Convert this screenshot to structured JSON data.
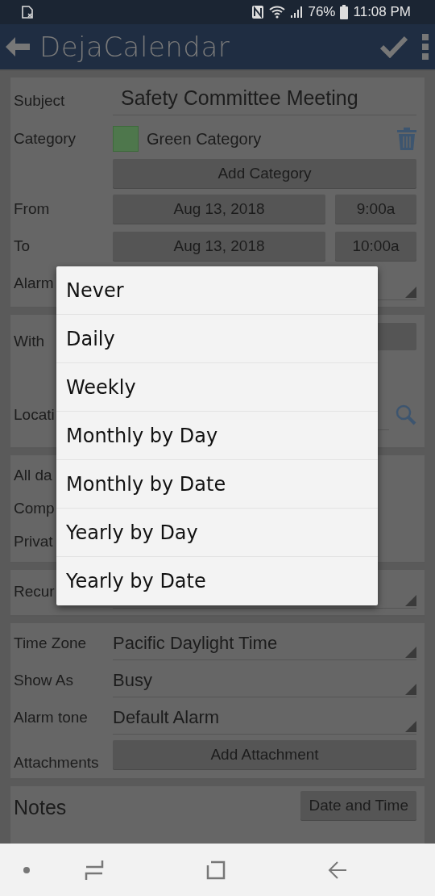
{
  "status_bar": {
    "battery": "76%",
    "time": "11:08 PM"
  },
  "app_bar": {
    "title": "DejaCalendar"
  },
  "details": {
    "subject": {
      "label": "Subject",
      "value": "Safety Committee Meeting"
    },
    "category": {
      "label": "Category",
      "name": "Green Category",
      "color": "#4e774c"
    },
    "add_category": "Add Category",
    "from": {
      "label": "From",
      "date": "Aug 13, 2018",
      "time": "9:00a"
    },
    "to": {
      "label": "To",
      "date": "Aug 13, 2018",
      "time": "10:00a"
    },
    "alarm": {
      "label": "Alarm"
    }
  },
  "people": {
    "with": {
      "label": "With"
    },
    "location": {
      "label": "Locati"
    }
  },
  "flags": [
    {
      "label": "All da"
    },
    {
      "label": "Comp"
    },
    {
      "label": "Privat"
    }
  ],
  "recurrence": {
    "label": "Recur"
  },
  "options": [
    {
      "label": "Time Zone",
      "kind": "dropdown",
      "value": "Pacific Daylight Time"
    },
    {
      "label": "Show As",
      "kind": "dropdown",
      "value": "Busy"
    },
    {
      "label": "Alarm tone",
      "kind": "dropdown",
      "value": "Default Alarm"
    },
    {
      "label": "Attachments",
      "kind": "button",
      "value": "Add Attachment"
    }
  ],
  "notes": {
    "title": "Notes",
    "button": "Date and Time"
  },
  "recurrence_menu": [
    "Never",
    "Daily",
    "Weekly",
    "Monthly by Day",
    "Monthly by Date",
    "Yearly by Day",
    "Yearly by Date"
  ]
}
